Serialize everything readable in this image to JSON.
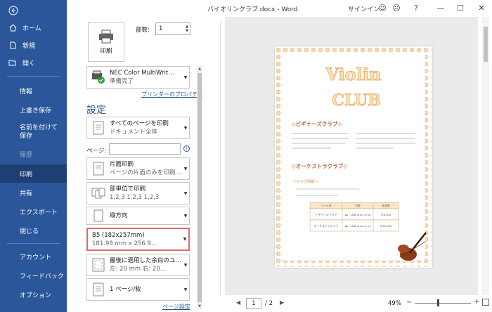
{
  "window": {
    "title": "バイオリンクラブ.docx - Word",
    "signin": "サインイン"
  },
  "nav": {
    "items": [
      {
        "label": "ホーム",
        "icon": "home-icon"
      },
      {
        "label": "新規",
        "icon": "new-document-icon"
      },
      {
        "label": "開く",
        "icon": "open-folder-icon"
      },
      {
        "label": "情報"
      },
      {
        "label": "上書き保存"
      },
      {
        "label": "名前を付けて保存"
      },
      {
        "label": "履歴"
      },
      {
        "label": "印刷"
      },
      {
        "label": "共有"
      },
      {
        "label": "エクスポート"
      },
      {
        "label": "閉じる"
      },
      {
        "label": "アカウント"
      },
      {
        "label": "フィードバック"
      },
      {
        "label": "オプション"
      }
    ]
  },
  "print": {
    "button_label": "印刷",
    "copies_label": "部数:",
    "copies_value": "1",
    "printer_name": "NEC Color MultiWrit…",
    "printer_status": "準備完了",
    "printer_props_link": "プリンターのプロパティ",
    "settings_title": "設定",
    "pages_label": "ページ:",
    "pages_value": "",
    "page_setup_link": "ページ設定"
  },
  "settings": [
    {
      "l1": "すべてのページを印刷",
      "l2": "ドキュメント全体"
    },
    {
      "l1": "片面印刷",
      "l2": "ページの片面のみを印刷…"
    },
    {
      "l1": "部単位で印刷",
      "l2": "1,2,3    1,2,3    1,2,3"
    },
    {
      "l1": "縦方向",
      "l2": ""
    },
    {
      "l1": "B5 (182x257mm)",
      "l2": "181.98 mm x 256.9…"
    },
    {
      "l1": "最後に適用した余白のユ…",
      "l2": "左:  20 mm    右: 20…"
    },
    {
      "l1": "1 ページ/枚",
      "l2": ""
    }
  ],
  "document": {
    "title_line1": "Violin",
    "title_line2": "CLUB",
    "heading1": "◇ビギナーズクラブ◇",
    "heading2": "◇オーケストラクラブ◇",
    "info_heading": "～クラブ情報～",
    "table": {
      "headers": [
        "コース名",
        "日程",
        "年会費"
      ],
      "rows": [
        [
          "ビギナーズクラブ",
          "第1・3水曜 18:00～17:00",
          "￥8,000"
        ],
        [
          "オーケストラクラブ",
          "第2・4水曜 18:00～17:00",
          "￥10,000"
        ]
      ]
    }
  },
  "statusbar": {
    "page_current": "1",
    "page_total": "/ 2",
    "zoom": "49%"
  }
}
